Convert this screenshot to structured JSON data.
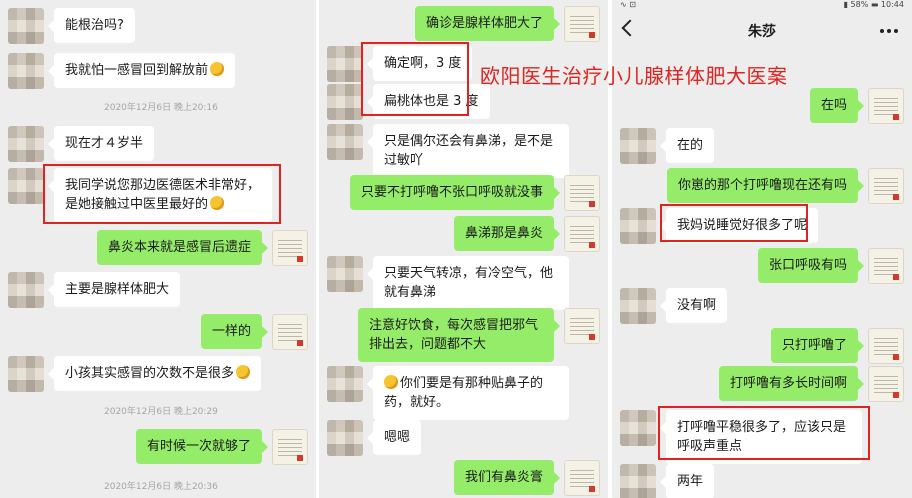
{
  "overlay_title": "欧阳医生治疗小儿腺样体肥大医案",
  "panel1": {
    "m1": "能根治吗?",
    "m2": "我就怕一感冒回到解放前",
    "ts1": "2020年12月6日 晚上20:16",
    "m3": "现在才４岁半",
    "m4": "我同学说您那边医德医术非常好，是她接触过中医里最好的",
    "m5": "鼻炎本来就是感冒后遗症",
    "m6": "主要是腺样体肥大",
    "m7": "一样的",
    "m8": "小孩其实感冒的次数不是很多",
    "ts2": "2020年12月6日 晚上20:29",
    "m9": "有时候一次就够了",
    "ts3": "2020年12月6日 晚上20:36"
  },
  "panel2": {
    "m1": "确诊是腺样体肥大了",
    "m2": "确定啊，3 度",
    "m3": "扁桃体也是 3 度",
    "m4": "只是偶尔还会有鼻涕，是不是过敏吖",
    "m5": "只要不打呼噜不张口呼吸就没事",
    "m6": "鼻涕那是鼻炎",
    "m7": "只要天气转凉，有冷空气，他就有鼻涕",
    "m8": "注意好饮食，每次感冒把邪气排出去，问题都不大",
    "m9": "你们要是有那种贴鼻子的药，就好。",
    "m10": "嗯嗯",
    "m11": "我们有鼻炎膏"
  },
  "panel3": {
    "status_left": "∿ ⊡",
    "status_right": "▮ 58% ▬ 10:44",
    "contact_name": "朱莎",
    "m1": "在吗",
    "m2": "在的",
    "m3": "你崽的那个打呼噜现在还有吗",
    "m4": "我妈说睡觉好很多了呢",
    "m5": "张口呼吸有吗",
    "m6": "没有啊",
    "m7": "只打呼噜了",
    "m8": "打呼噜有多长时间啊",
    "m9": "打呼噜平稳很多了，应该只是呼吸声重点",
    "m10": "两年"
  },
  "icons": {
    "back": "back-arrow-icon",
    "more": "more-dots-icon",
    "emoji": "smiley-emoji-icon"
  },
  "colors": {
    "chat_bg": "#ededed",
    "own_bubble": "#95ec69",
    "other_bubble": "#ffffff",
    "highlight": "#e0231f"
  }
}
